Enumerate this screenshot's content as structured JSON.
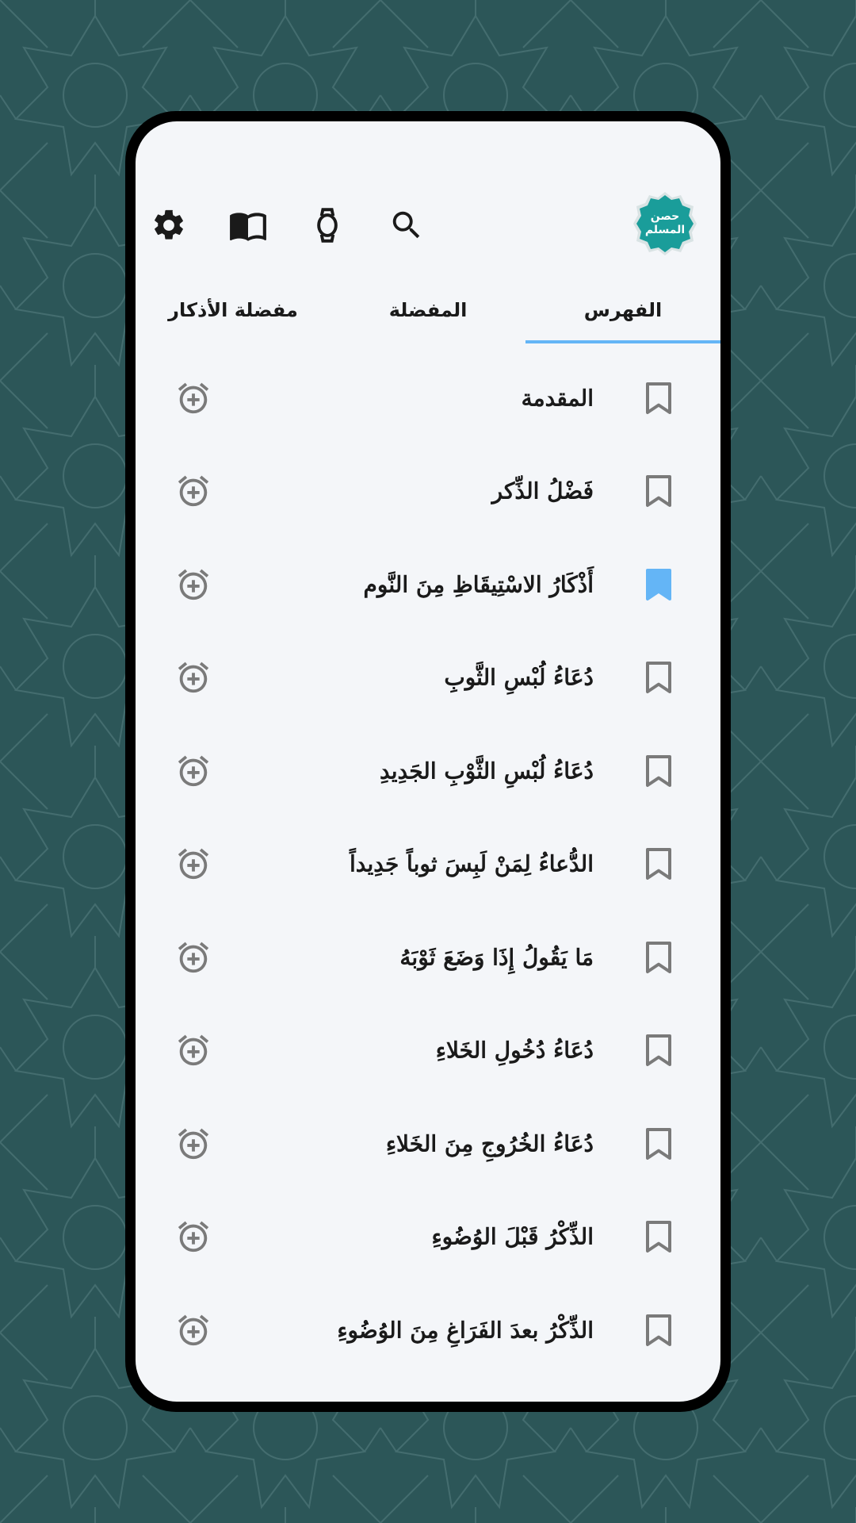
{
  "app": {
    "logo_line1": "حصن",
    "logo_line2": "المسلم",
    "accent_color": "#64b5f6",
    "logo_color": "#1a9d9a",
    "background_color": "#2c5658"
  },
  "toolbar": {
    "icons": [
      "gear-icon",
      "book-icon",
      "watch-icon",
      "search-icon"
    ]
  },
  "tabs": [
    {
      "label": "الفهرس",
      "active": true
    },
    {
      "label": "المفضلة",
      "active": false
    },
    {
      "label": "مفضلة الأذكار",
      "active": false
    }
  ],
  "list": [
    {
      "title": "المقدمة",
      "bookmarked": false
    },
    {
      "title": "فَضْلُ الذِّكر",
      "bookmarked": false
    },
    {
      "title": "أَذْكَارُ الاسْتِيقَاظِ مِنَ النَّوم",
      "bookmarked": true
    },
    {
      "title": "دُعَاءُ لُبْسِ الثَّوبِ",
      "bookmarked": false
    },
    {
      "title": "دُعَاءُ لُبْسِ الثَّوْبِ الجَدِيدِ",
      "bookmarked": false
    },
    {
      "title": "الدُّعاءُ لِمَنْ لَبِسَ ثوباً جَدِيداً",
      "bookmarked": false
    },
    {
      "title": "مَا يَقُولُ إِذَا وَضَعَ ثَوْبَهُ",
      "bookmarked": false
    },
    {
      "title": "دُعَاءُ دُخُولِ الخَلاءِ",
      "bookmarked": false
    },
    {
      "title": "دُعَاءُ الخُرُوجِ مِنَ الخَلاءِ",
      "bookmarked": false
    },
    {
      "title": "الذِّكْرُ قَبْلَ الوُضُوءِ",
      "bookmarked": false
    },
    {
      "title": "الذِّكْرُ بعدَ الفَرَاغِ مِنَ الوُضُوءِ",
      "bookmarked": false
    }
  ]
}
